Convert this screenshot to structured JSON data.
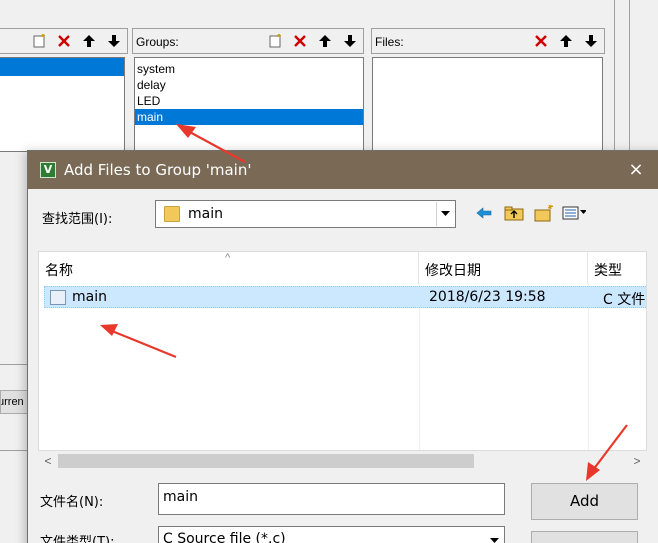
{
  "background": {
    "groups_label": "Groups:",
    "files_label": "Files:",
    "groups": [
      {
        "label": "system",
        "selected": false
      },
      {
        "label": "delay",
        "selected": false
      },
      {
        "label": "LED",
        "selected": false
      },
      {
        "label": "main",
        "selected": true
      }
    ],
    "partial_button_label": "urren"
  },
  "dialog": {
    "title": "Add Files to Group 'main'",
    "close_icon": "×",
    "look_in_label": "查找范围(I):",
    "look_in_value": "main",
    "columns": {
      "name": "名称",
      "modified": "修改日期",
      "type": "类型"
    },
    "files": [
      {
        "name": "main",
        "modified": "2018/6/23 19:58",
        "type": "C 文件"
      }
    ],
    "file_name_label": "文件名(N):",
    "file_name_value": "main",
    "file_type_label": "文件类型(T):",
    "file_type_value": "C Source file (*.c)",
    "add_label": "Add"
  },
  "colors": {
    "selection": "#0078d7",
    "row_highlight": "#cce8ff",
    "titlebar": "#7a6a55",
    "annotation_arrow": "#e8382c"
  }
}
